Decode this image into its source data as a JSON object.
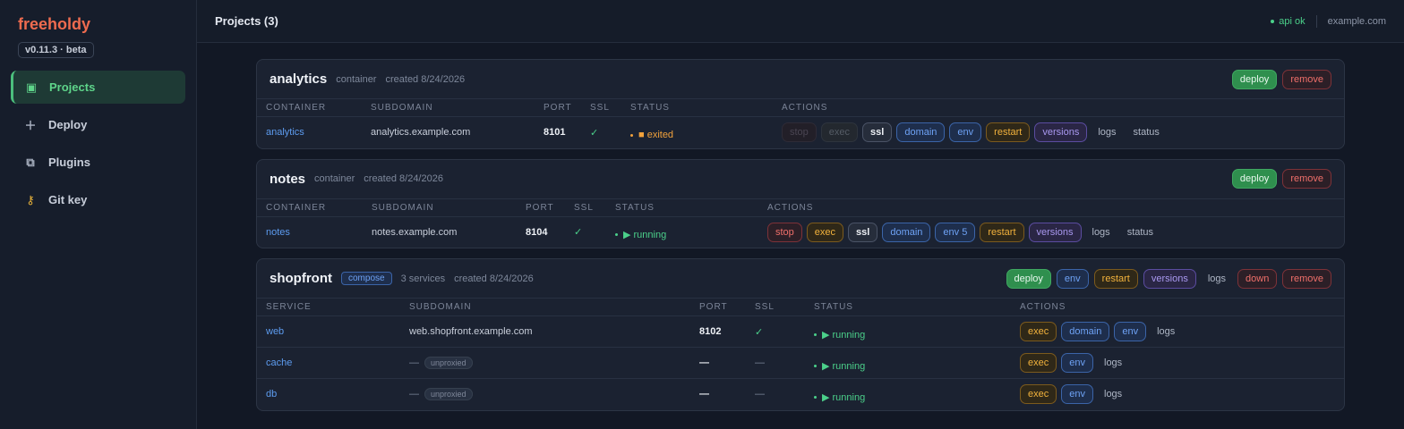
{
  "app": {
    "brand": "freeholdy",
    "version": "v0.11.3 · beta"
  },
  "sidebar": {
    "items": [
      {
        "label": "Projects",
        "icon": "grid-icon"
      },
      {
        "label": "Deploy",
        "icon": "plus-icon"
      },
      {
        "label": "Plugins",
        "icon": "plugins-icon"
      },
      {
        "label": "Git key",
        "icon": "key-icon"
      }
    ]
  },
  "header": {
    "title": "Projects (3)",
    "api_status": "api ok",
    "host": "example.com"
  },
  "projects": [
    {
      "name": "analytics",
      "kind": "container",
      "created": "created 8/24/2026",
      "actions": {
        "deploy": "deploy",
        "remove": "remove"
      },
      "columns": [
        "CONTAINER",
        "SUBDOMAIN",
        "PORT",
        "SSL",
        "STATUS",
        "ACTIONS"
      ],
      "rows": [
        {
          "name": "analytics",
          "subdomain": "analytics.example.com",
          "port": "8101",
          "ssl": "✓",
          "status": "■ exited",
          "actions": [
            "stop",
            "exec",
            "ssl",
            "domain",
            "env",
            "restart",
            "versions",
            "logs",
            "status"
          ]
        }
      ]
    },
    {
      "name": "notes",
      "kind": "container",
      "created": "created 8/24/2026",
      "actions": {
        "deploy": "deploy",
        "remove": "remove"
      },
      "columns": [
        "CONTAINER",
        "SUBDOMAIN",
        "PORT",
        "SSL",
        "STATUS",
        "ACTIONS"
      ],
      "rows": [
        {
          "name": "notes",
          "subdomain": "notes.example.com",
          "port": "8104",
          "ssl": "✓",
          "status": "▶ running",
          "actions": [
            "stop",
            "exec",
            "ssl",
            "domain",
            "env 5",
            "restart",
            "versions",
            "logs",
            "status"
          ]
        }
      ]
    },
    {
      "name": "shopfront",
      "badge": "compose",
      "services": "3 services",
      "created": "created 8/24/2026",
      "actions": {
        "deploy": "deploy",
        "env": "env",
        "restart": "restart",
        "versions": "versions",
        "logs": "logs",
        "down": "down",
        "remove": "remove"
      },
      "columns": [
        "SERVICE",
        "SUBDOMAIN",
        "PORT",
        "SSL",
        "STATUS",
        "ACTIONS"
      ],
      "rows": [
        {
          "name": "web",
          "subdomain": "web.shopfront.example.com",
          "port": "8102",
          "ssl": "✓",
          "status": "▶ running",
          "actions": [
            "exec",
            "domain",
            "env",
            "logs"
          ]
        },
        {
          "name": "cache",
          "subdomain": "—",
          "tag": "unproxied",
          "port": "—",
          "ssl": "—",
          "status": "▶ running",
          "actions": [
            "exec",
            "env",
            "logs"
          ]
        },
        {
          "name": "db",
          "subdomain": "—",
          "tag": "unproxied",
          "port": "—",
          "ssl": "—",
          "status": "▶ running",
          "actions": [
            "exec",
            "env",
            "logs"
          ]
        }
      ]
    }
  ]
}
